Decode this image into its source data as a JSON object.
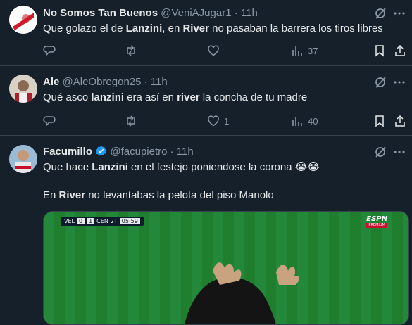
{
  "tweets": [
    {
      "name": "No Somos Tan Buenos",
      "handle": "@VeniAJugar1",
      "dot": "·",
      "time": "11h",
      "text_parts": [
        "Que golazo el de ",
        "Lanzini",
        ", en ",
        "River",
        " no pasaban la barrera los tiros libres"
      ],
      "reply_count": "",
      "retweet_count": "",
      "like_count": "",
      "views_count": "37"
    },
    {
      "name": "Ale",
      "handle": "@AleObregon25",
      "dot": "·",
      "time": "11h",
      "text_parts": [
        "Qué asco ",
        "lanzini",
        " era así en ",
        "river",
        " la concha de tu madre"
      ],
      "reply_count": "",
      "retweet_count": "",
      "like_count": "1",
      "views_count": "40"
    },
    {
      "name": "Facumillo",
      "handle": "@facupietro",
      "dot": "·",
      "time": "11h",
      "verified": true,
      "text_parts": [
        "Que hace ",
        "Lanzini",
        " en el festejo poniendose la corona ",
        "😭😭"
      ],
      "text_line2_parts": [
        "En ",
        "River",
        " no levantabas la pelota del piso Manolo"
      ],
      "media": {
        "home_team": "VEL",
        "home_score": "0",
        "away_score": "1",
        "away_team": "CEN",
        "period": "2T",
        "clock": "05:59",
        "network": "ESPN",
        "network_sub": "PREMIUM",
        "pitch_color": "#1e7a2c"
      }
    }
  ],
  "colors": {
    "background": "#15202b",
    "text": "#e7e9ea",
    "secondary": "#8b98a5",
    "divider": "#38444d",
    "verified": "#1d9bf0"
  },
  "icons": [
    "grok-icon",
    "more-icon",
    "reply-icon",
    "retweet-icon",
    "like-icon",
    "views-icon",
    "bookmark-icon",
    "share-icon",
    "verified-icon"
  ]
}
